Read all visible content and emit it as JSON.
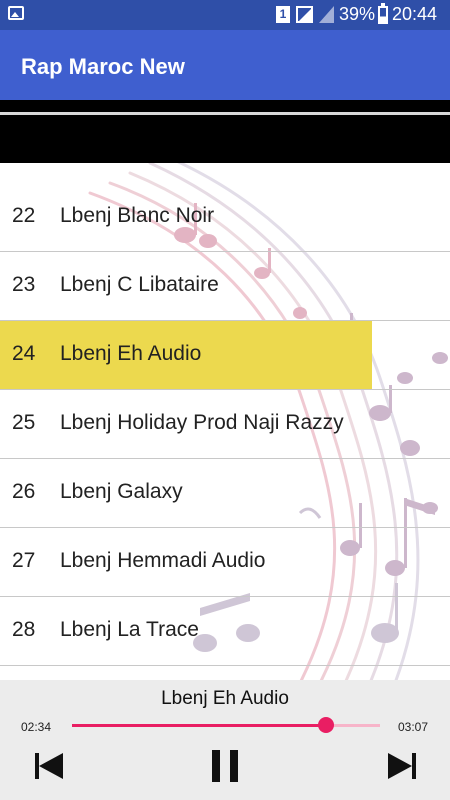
{
  "status_bar": {
    "sim_label": "1",
    "battery_percent": "39%",
    "battery_level": 0.39,
    "time": "20:44"
  },
  "app_bar": {
    "title": "Rap Maroc New"
  },
  "tracks": [
    {
      "number": "22",
      "title": "Lbenj Blanc Noir",
      "selected": false
    },
    {
      "number": "23",
      "title": "Lbenj C Libataire",
      "selected": false
    },
    {
      "number": "24",
      "title": "Lbenj Eh Audio",
      "selected": true
    },
    {
      "number": "25",
      "title": "Lbenj Holiday Prod Naji Razzy",
      "selected": false
    },
    {
      "number": "26",
      "title": "Lbenj Galaxy",
      "selected": false
    },
    {
      "number": "27",
      "title": "Lbenj Hemmadi Audio",
      "selected": false
    },
    {
      "number": "28",
      "title": "Lbenj La Trace",
      "selected": false
    }
  ],
  "player": {
    "now_playing": "Lbenj Eh Audio",
    "current_time": "02:34",
    "total_time": "03:07",
    "progress": 0.825,
    "controls": {
      "previous_icon": "skip-previous-icon",
      "pause_icon": "pause-icon",
      "next_icon": "skip-next-icon"
    }
  },
  "colors": {
    "status_bar": "#2f4fa8",
    "app_bar": "#3f5fcf",
    "highlight": "#ecd94e",
    "seek_accent": "#e91e63"
  }
}
